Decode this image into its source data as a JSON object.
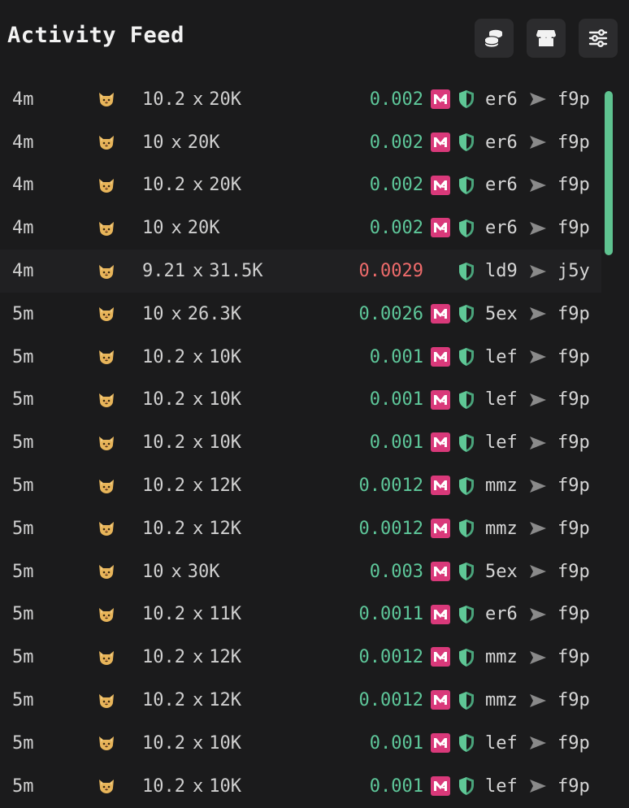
{
  "header": {
    "title": "Activity Feed",
    "buttons": [
      {
        "name": "coins-icon"
      },
      {
        "name": "store-icon"
      },
      {
        "name": "sliders-icon"
      }
    ]
  },
  "colors": {
    "background": "#1b1b1c",
    "accent_green": "#5ec79a",
    "sell_red": "#ee6b6b",
    "badge_pink": "#d9397a",
    "scrollbar": "#5fc390"
  },
  "icons": {
    "moon": "crescent-moon-icon",
    "cat": "cat-face-icon",
    "badge": "m-badge-icon",
    "shield": "shield-icon",
    "arrow": "arrow-right-icon"
  },
  "rows": [
    {
      "time": "4m",
      "price": "10.2",
      "qty": "20K",
      "amount": "0.002",
      "side": "buy",
      "badge": true,
      "from": "er6",
      "to": "f9p"
    },
    {
      "time": "4m",
      "price": "10",
      "qty": "20K",
      "amount": "0.002",
      "side": "buy",
      "badge": true,
      "from": "er6",
      "to": "f9p"
    },
    {
      "time": "4m",
      "price": "10.2",
      "qty": "20K",
      "amount": "0.002",
      "side": "buy",
      "badge": true,
      "from": "er6",
      "to": "f9p"
    },
    {
      "time": "4m",
      "price": "10",
      "qty": "20K",
      "amount": "0.002",
      "side": "buy",
      "badge": true,
      "from": "er6",
      "to": "f9p"
    },
    {
      "time": "4m",
      "price": "9.21",
      "qty": "31.5K",
      "amount": "0.0029",
      "side": "sell",
      "badge": false,
      "from": "ld9",
      "to": "j5y"
    },
    {
      "time": "5m",
      "price": "10",
      "qty": "26.3K",
      "amount": "0.0026",
      "side": "buy",
      "badge": true,
      "from": "5ex",
      "to": "f9p"
    },
    {
      "time": "5m",
      "price": "10.2",
      "qty": "10K",
      "amount": "0.001",
      "side": "buy",
      "badge": true,
      "from": "lef",
      "to": "f9p"
    },
    {
      "time": "5m",
      "price": "10.2",
      "qty": "10K",
      "amount": "0.001",
      "side": "buy",
      "badge": true,
      "from": "lef",
      "to": "f9p"
    },
    {
      "time": "5m",
      "price": "10.2",
      "qty": "10K",
      "amount": "0.001",
      "side": "buy",
      "badge": true,
      "from": "lef",
      "to": "f9p"
    },
    {
      "time": "5m",
      "price": "10.2",
      "qty": "12K",
      "amount": "0.0012",
      "side": "buy",
      "badge": true,
      "from": "mmz",
      "to": "f9p"
    },
    {
      "time": "5m",
      "price": "10.2",
      "qty": "12K",
      "amount": "0.0012",
      "side": "buy",
      "badge": true,
      "from": "mmz",
      "to": "f9p"
    },
    {
      "time": "5m",
      "price": "10",
      "qty": "30K",
      "amount": "0.003",
      "side": "buy",
      "badge": true,
      "from": "5ex",
      "to": "f9p"
    },
    {
      "time": "5m",
      "price": "10.2",
      "qty": "11K",
      "amount": "0.0011",
      "side": "buy",
      "badge": true,
      "from": "er6",
      "to": "f9p"
    },
    {
      "time": "5m",
      "price": "10.2",
      "qty": "12K",
      "amount": "0.0012",
      "side": "buy",
      "badge": true,
      "from": "mmz",
      "to": "f9p"
    },
    {
      "time": "5m",
      "price": "10.2",
      "qty": "12K",
      "amount": "0.0012",
      "side": "buy",
      "badge": true,
      "from": "mmz",
      "to": "f9p"
    },
    {
      "time": "5m",
      "price": "10.2",
      "qty": "10K",
      "amount": "0.001",
      "side": "buy",
      "badge": true,
      "from": "lef",
      "to": "f9p"
    },
    {
      "time": "5m",
      "price": "10.2",
      "qty": "10K",
      "amount": "0.001",
      "side": "buy",
      "badge": true,
      "from": "lef",
      "to": "f9p"
    }
  ],
  "scroll": {
    "thumb_fraction": 0.23
  }
}
